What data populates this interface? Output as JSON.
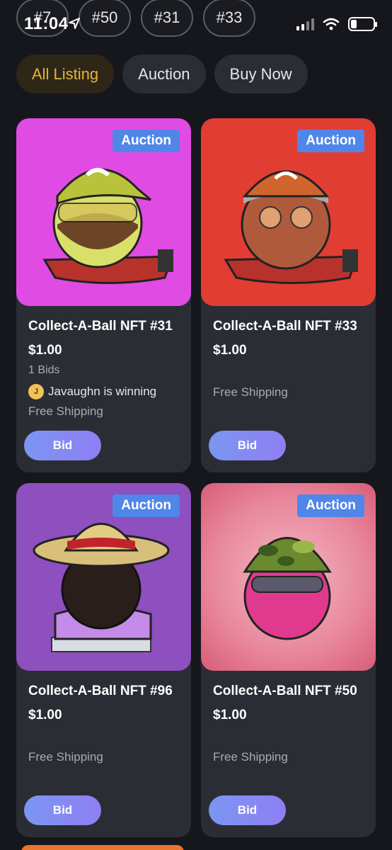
{
  "status_bar": {
    "time": "11:04"
  },
  "top_chips": [
    "#7",
    "#50",
    "#31",
    "#33"
  ],
  "tabs": [
    {
      "label": "All Listing",
      "active": true
    },
    {
      "label": "Auction",
      "active": false
    },
    {
      "label": "Buy Now",
      "active": false
    }
  ],
  "cards": [
    {
      "badge": "Auction",
      "title": "Collect-A-Ball NFT #31",
      "price": "$1.00",
      "bids": "1 Bids",
      "winner": "Javaughn is winning",
      "shipping": "Free Shipping",
      "button": "Bid",
      "bg_color": "#e04be4"
    },
    {
      "badge": "Auction",
      "title": "Collect-A-Ball NFT #33",
      "price": "$1.00",
      "shipping": "Free Shipping",
      "button": "Bid",
      "bg_color": "#e23d33"
    },
    {
      "badge": "Auction",
      "title": "Collect-A-Ball NFT #96",
      "price": "$1.00",
      "shipping": "Free Shipping",
      "button": "Bid",
      "bg_color": "#8e4fbf"
    },
    {
      "badge": "Auction",
      "title": "Collect-A-Ball NFT #50",
      "price": "$1.00",
      "shipping": "Free Shipping",
      "button": "Bid",
      "bg_color": "#e8879b"
    }
  ],
  "colors": {
    "accent": "#e5b33a",
    "badge": "#4f86e8",
    "card": "#2b2d34"
  }
}
